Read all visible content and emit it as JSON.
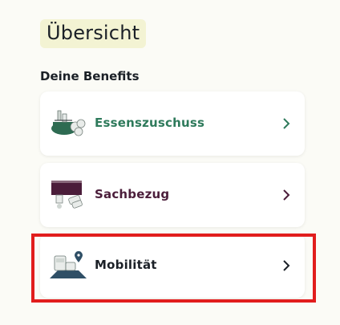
{
  "header": {
    "title": "Übersicht"
  },
  "section": {
    "label": "Deine Benefits"
  },
  "benefits": [
    {
      "label": "Essenszuschuss",
      "icon": "food-allowance-icon",
      "color": "#2e7a5b"
    },
    {
      "label": "Sachbezug",
      "icon": "benefit-in-kind-icon",
      "color": "#4b1d3a"
    },
    {
      "label": "Mobilität",
      "icon": "mobility-icon",
      "color": "#1b2027"
    }
  ],
  "colors": {
    "background": "#fbfbf6",
    "title_bg": "#f3f3d3",
    "highlight": "#e11d1d"
  }
}
